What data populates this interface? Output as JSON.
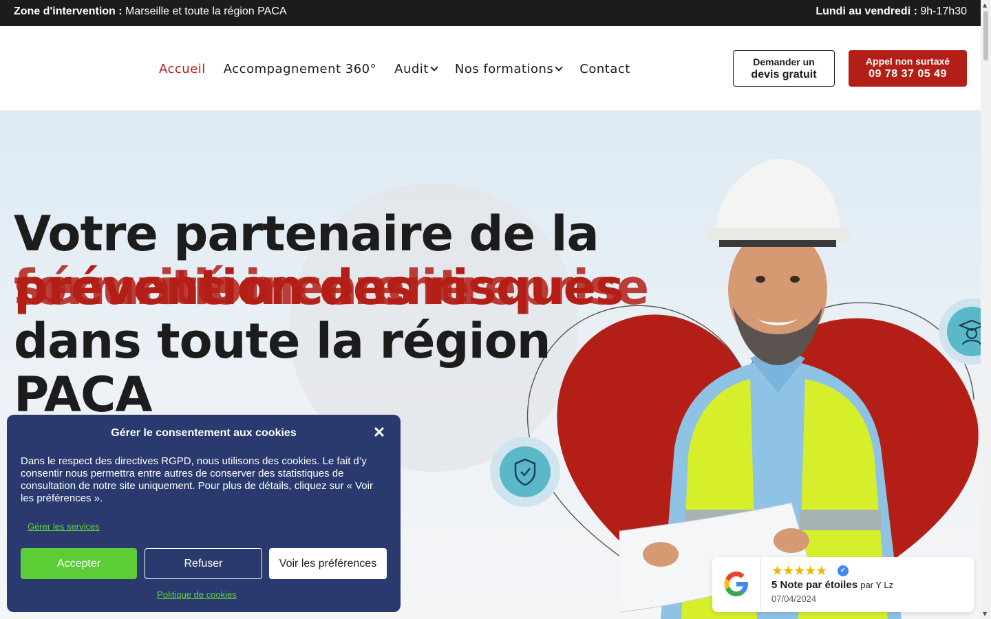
{
  "topbar": {
    "zone_label": "Zone d'intervention :",
    "zone_value": "Marseille et toute la région PACA",
    "hours_label": "Lundi au vendredi :",
    "hours_value": "9h-17h30"
  },
  "nav": {
    "items": [
      {
        "label": "Accueil",
        "active": true,
        "dropdown": false
      },
      {
        "label": "Accompagnement 360°",
        "active": false,
        "dropdown": false
      },
      {
        "label": "Audit",
        "active": false,
        "dropdown": true
      },
      {
        "label": "Nos formations",
        "active": false,
        "dropdown": true
      },
      {
        "label": "Contact",
        "active": false,
        "dropdown": false
      }
    ]
  },
  "cta": {
    "devis_line1": "Demander un",
    "devis_line2": "devis gratuit",
    "call_line1": "Appel non surtaxé",
    "call_line2": "09 78 37 05 49"
  },
  "hero": {
    "line1": "Votre partenaire de la",
    "red_overlap": [
      "prévention des risques",
      "sécurité incendie",
      "formation en entreprise"
    ],
    "line3": "dans toute la région",
    "line4": "PACA"
  },
  "cookie": {
    "title": "Gérer le consentement aux cookies",
    "close_symbol": "✕",
    "text": "Dans le respect des directives RGPD, nous utilisons des cookies. Le fait d’y consentir nous permettra entre autres de conserver des statistiques de consultation de notre site uniquement. Pour plus de détails, cliquez sur « Voir les préférences ».",
    "manage_link": "Gérer les services",
    "accept": "Accepter",
    "refuse": "Refuser",
    "preferences": "Voir les préférences",
    "policy_link": "Politique de cookies"
  },
  "review": {
    "stars": "★★★★★",
    "rating_bold": "5 Note par étoiles",
    "by": "par Y Lz",
    "date": "07/04/2024"
  },
  "colors": {
    "brand_red": "#b31f17",
    "topbar_bg": "#1c1c1c",
    "cookie_bg": "#2a3a6e",
    "accept_green": "#5ccd37",
    "badge_teal": "#5ab8c9"
  }
}
